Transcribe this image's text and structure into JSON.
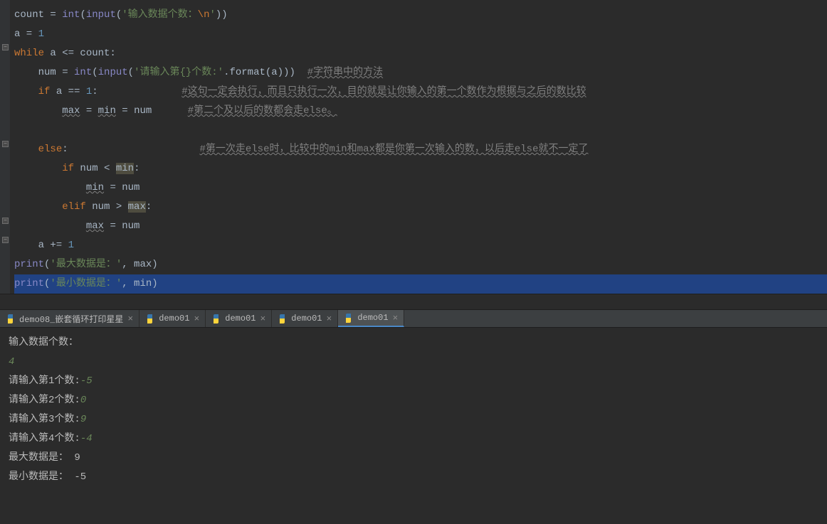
{
  "code": {
    "l1": {
      "t1": "count = ",
      "fn1": "int",
      "t2": "(",
      "fn2": "input",
      "t3": "(",
      "s1": "'输入数据个数：",
      "esc": "\\n",
      "s2": "'",
      "t4": "))"
    },
    "l2": {
      "t1": "a = ",
      "n1": "1"
    },
    "l3": {
      "kw": "while",
      "t1": " a <= count:"
    },
    "l4": {
      "t1": "    num = ",
      "fn1": "int",
      "t2": "(",
      "fn2": "input",
      "t3": "(",
      "s1": "'请输入第{}个数:'",
      "t4": ".format(a)))",
      "sp": "  ",
      "c1": "#字符串中的方法"
    },
    "l5": {
      "t1": "    ",
      "kw": "if",
      "t2": " a == ",
      "n1": "1",
      "t3": ":",
      "sp": "              ",
      "c1": "#这句一定会执行，而且只执行一次，目的就是让你输入的第一个数作为根据与之后的数比较"
    },
    "l6": {
      "t1": "        ",
      "u1": "max",
      "t2": " = ",
      "u2": "min",
      "t3": " = num",
      "sp": "      ",
      "c1": "#第二个及以后的数都会走else。"
    },
    "l7": {
      "t1": ""
    },
    "l8": {
      "t1": "    ",
      "kw": "else",
      "t2": ":",
      "sp": "                      ",
      "c1": "#第一次走else时，比较中的min和max都是你第一次输入的数，以后走else就不一定了"
    },
    "l9": {
      "t1": "        ",
      "kw": "if",
      "t2": " num < ",
      "hl": "min",
      "t3": ":"
    },
    "l10": {
      "t1": "            ",
      "u1": "min",
      "t2": " = num"
    },
    "l11": {
      "t1": "        ",
      "kw": "elif",
      "t2": " num > ",
      "hl": "max",
      "t3": ":"
    },
    "l12": {
      "t1": "            ",
      "u1": "max",
      "t2": " = num"
    },
    "l13": {
      "t1": "    a += ",
      "n1": "1"
    },
    "l14": {
      "fn1": "print",
      "t1": "(",
      "s1": "'最大数据是：'",
      "t2": ", max)"
    },
    "l15": {
      "fn1": "print",
      "t1": "(",
      "s1": "'最小数据是：'",
      "t2": ", min)"
    }
  },
  "tabs": [
    {
      "label": "demo08_嵌套循环打印星星"
    },
    {
      "label": "demo01"
    },
    {
      "label": "demo01"
    },
    {
      "label": "demo01"
    },
    {
      "label": "demo01"
    }
  ],
  "console": {
    "l1": "输入数据个数：",
    "l2": "4",
    "l3p": "请输入第1个数:",
    "l3v": "-5",
    "l4p": "请输入第2个数:",
    "l4v": "0",
    "l5p": "请输入第3个数:",
    "l5v": "9",
    "l6p": "请输入第4个数:",
    "l6v": "-4",
    "l7": "最大数据是： 9",
    "l8": "最小数据是： -5"
  }
}
